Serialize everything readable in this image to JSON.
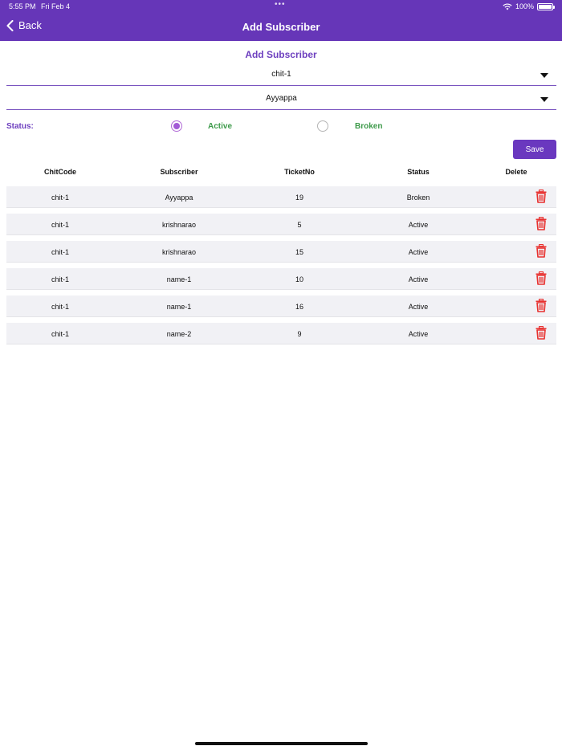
{
  "status_bar": {
    "time": "5:55 PM",
    "date": "Fri Feb 4",
    "battery": "100%"
  },
  "nav": {
    "back_label": "Back",
    "title": "Add Subscriber"
  },
  "form": {
    "title": "Add Subscriber",
    "chit_dropdown": "chit-1",
    "subscriber_dropdown": "Ayyappa",
    "status_label": "Status:",
    "radio_active": "Active",
    "radio_broken": "Broken",
    "selected_status": "Active",
    "save_label": "Save"
  },
  "table": {
    "headers": [
      "ChitCode",
      "Subscriber",
      "TicketNo",
      "Status",
      "Delete"
    ],
    "rows": [
      {
        "chit": "chit-1",
        "subscriber": "Ayyappa",
        "ticket": "19",
        "status": "Broken"
      },
      {
        "chit": "chit-1",
        "subscriber": "krishnarao",
        "ticket": "5",
        "status": "Active"
      },
      {
        "chit": "chit-1",
        "subscriber": "krishnarao",
        "ticket": "15",
        "status": "Active"
      },
      {
        "chit": "chit-1",
        "subscriber": "name-1",
        "ticket": "10",
        "status": "Active"
      },
      {
        "chit": "chit-1",
        "subscriber": "name-1",
        "ticket": "16",
        "status": "Active"
      },
      {
        "chit": "chit-1",
        "subscriber": "name-2",
        "ticket": "9",
        "status": "Active"
      }
    ]
  },
  "colors": {
    "brand": "#6636b8",
    "accent_text": "#6d3fbf",
    "status_green": "#3d9a4a",
    "delete_red": "#e8312f",
    "row_bg": "#f1f1f5"
  },
  "icons": {
    "back": "chevron-left-icon",
    "dropdown": "caret-down-icon",
    "delete": "trash-icon",
    "wifi": "wifi-icon",
    "battery": "battery-icon"
  }
}
